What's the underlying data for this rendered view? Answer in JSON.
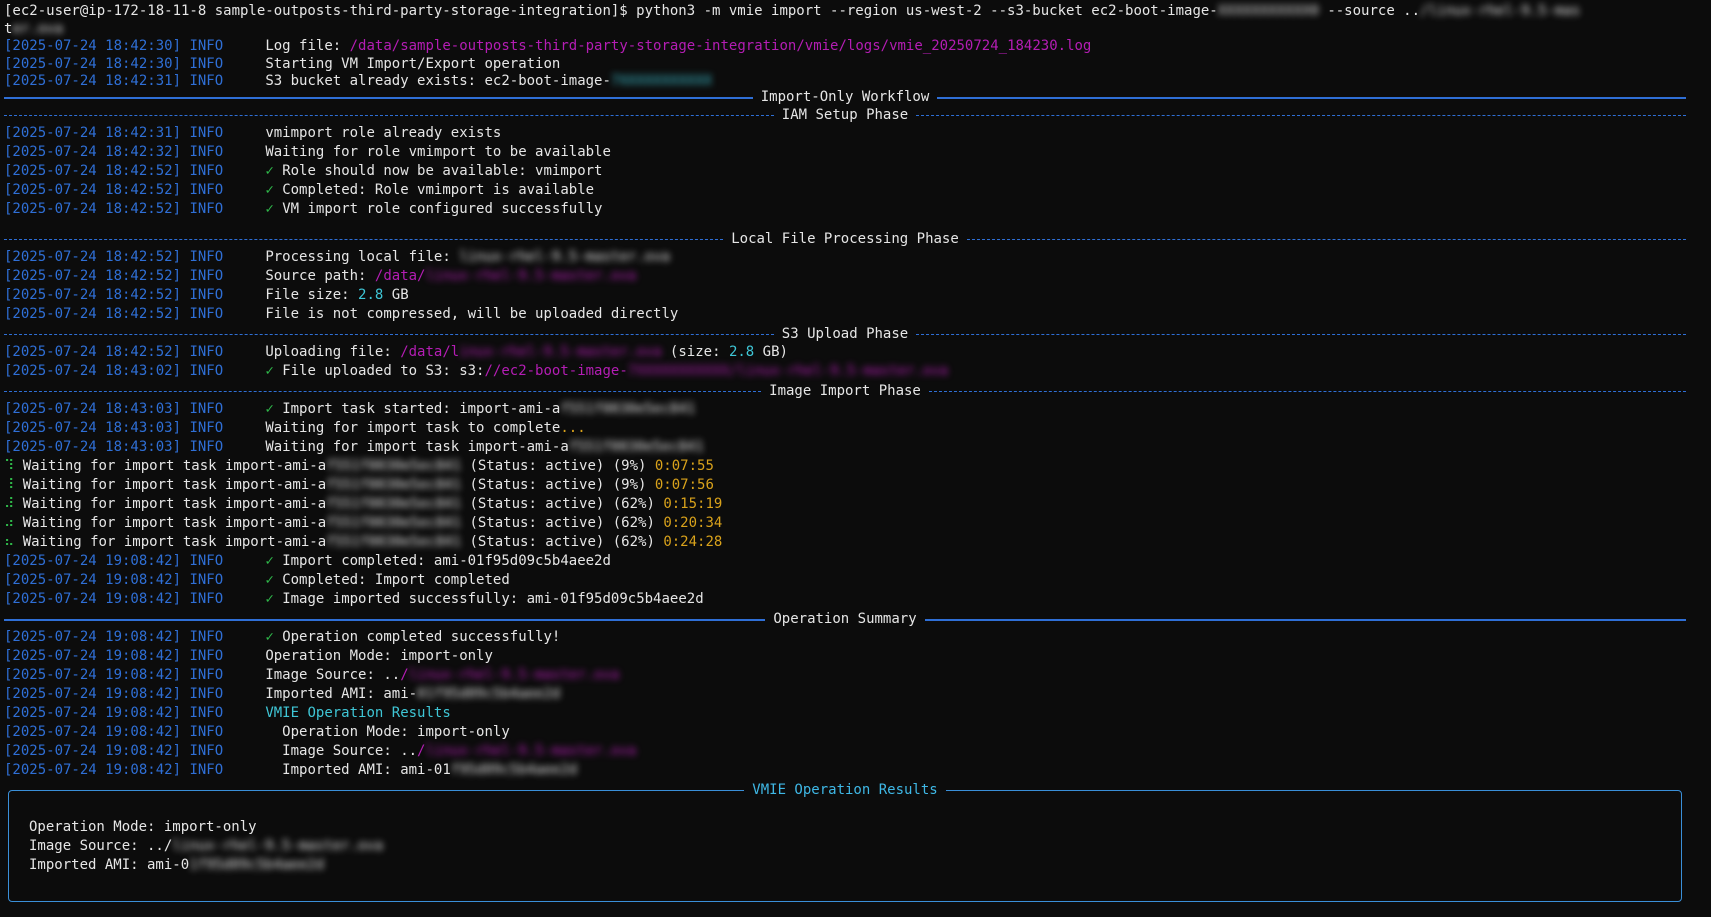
{
  "prompt": {
    "text": "[ec2-user@ip-172-18-11-8 sample-outposts-third-party-storage-integration]$ python3 -m vmie import --region us-west-2 --s3-bucket ec2-boot-image-",
    "bucket_suffix": "XXXXXXXXXXX0",
    "source_flag": " --source ..",
    "source_path": "/linux-rhel-9.5-mas",
    "wrap": "t",
    "wrap_blur": "er.ova"
  },
  "log_lines": [
    {
      "ts": "[2025-07-24 18:42:30]",
      "lvl": "INFO",
      "parts": [
        {
          "t": "Log file: ",
          "c": "msg"
        },
        {
          "t": "/data/sample-outposts-third-party-storage-integration/vmie/logs/vmie_20250724_184230.log",
          "c": "mag"
        }
      ]
    },
    {
      "ts": "[2025-07-24 18:42:30]",
      "lvl": "INFO",
      "parts": [
        {
          "t": "Starting VM Import/Export operation",
          "c": "msg"
        }
      ]
    },
    {
      "ts": "[2025-07-24 18:42:31]",
      "lvl": "INFO",
      "parts": [
        {
          "t": "S3 bucket already exists: ec2-boot-image-",
          "c": "msg"
        },
        {
          "t": "7XXXXXXXXXXX",
          "c": "cyan blur"
        }
      ]
    }
  ],
  "sections": {
    "import_only": "Import-Only Workflow",
    "iam": "IAM Setup Phase",
    "local": "Local File Processing Phase",
    "s3": "S3 Upload Phase",
    "image": "Image Import Phase",
    "summary": "Operation Summary"
  },
  "iam_lines": [
    {
      "ts": "[2025-07-24 18:42:31]",
      "lvl": "INFO",
      "check": false,
      "text": "vmimport role already exists"
    },
    {
      "ts": "[2025-07-24 18:42:32]",
      "lvl": "INFO",
      "check": false,
      "text": "Waiting for role vmimport to be available"
    },
    {
      "ts": "[2025-07-24 18:42:52]",
      "lvl": "INFO",
      "check": true,
      "text": "Role should now be available: vmimport"
    },
    {
      "ts": "[2025-07-24 18:42:52]",
      "lvl": "INFO",
      "check": true,
      "text": "Completed: Role vmimport is available"
    },
    {
      "ts": "[2025-07-24 18:42:52]",
      "lvl": "INFO",
      "check": true,
      "text": "VM import role configured successfully"
    }
  ],
  "local_lines": [
    {
      "ts": "[2025-07-24 18:42:52]",
      "lvl": "INFO",
      "parts": [
        {
          "t": "Processing local file: ",
          "c": "msg"
        },
        {
          "t": "linux-rhel-9.5-master.ova",
          "c": "msg blur"
        }
      ]
    },
    {
      "ts": "[2025-07-24 18:42:52]",
      "lvl": "INFO",
      "parts": [
        {
          "t": "Source path: ",
          "c": "msg"
        },
        {
          "t": "/data/",
          "c": "mag"
        },
        {
          "t": "linux-rhel-9.5-master.ova",
          "c": "mag blur"
        }
      ]
    },
    {
      "ts": "[2025-07-24 18:42:52]",
      "lvl": "INFO",
      "parts": [
        {
          "t": "File size: ",
          "c": "msg"
        },
        {
          "t": "2.8",
          "c": "cyan"
        },
        {
          "t": " GB",
          "c": "msg"
        }
      ]
    },
    {
      "ts": "[2025-07-24 18:42:52]",
      "lvl": "INFO",
      "parts": [
        {
          "t": "File is not compressed, will be uploaded directly",
          "c": "msg"
        }
      ]
    }
  ],
  "s3_lines": [
    {
      "ts": "[2025-07-24 18:42:52]",
      "lvl": "INFO",
      "parts": [
        {
          "t": "Uploading file: ",
          "c": "msg"
        },
        {
          "t": "/data/l",
          "c": "mag"
        },
        {
          "t": "inux-rhel-9.5-master.ova",
          "c": "mag blur"
        },
        {
          "t": " (size: ",
          "c": "msg"
        },
        {
          "t": "2.8",
          "c": "cyan"
        },
        {
          "t": " GB)",
          "c": "msg"
        }
      ]
    },
    {
      "ts": "[2025-07-24 18:43:02]",
      "lvl": "INFO",
      "parts": [
        {
          "t": "✓ ",
          "c": "green"
        },
        {
          "t": "File uploaded to S3: s3:",
          "c": "msg"
        },
        {
          "t": "//ec2-boot-image-",
          "c": "mag"
        },
        {
          "t": "7XXXXXXXXXXX/linux-rhel-9.5-master.ova",
          "c": "mag blur"
        }
      ]
    }
  ],
  "image_lines": [
    {
      "ts": "[2025-07-24 18:43:03]",
      "lvl": "INFO",
      "parts": [
        {
          "t": "✓ ",
          "c": "green"
        },
        {
          "t": "Import task started: import-ami-a",
          "c": "msg"
        },
        {
          "t": "f551f0030e5ec841",
          "c": "msg blur"
        }
      ]
    },
    {
      "ts": "[2025-07-24 18:43:03]",
      "lvl": "INFO",
      "parts": [
        {
          "t": "Waiting for import task to complete",
          "c": "msg"
        },
        {
          "t": "...",
          "c": "yellow"
        }
      ]
    },
    {
      "ts": "[2025-07-24 18:43:03]",
      "lvl": "INFO",
      "parts": [
        {
          "t": "Waiting for import task import-ami-a",
          "c": "msg"
        },
        {
          "t": "f551f0030e5ec841",
          "c": "msg blur"
        }
      ]
    }
  ],
  "progress_lines": [
    {
      "spin": "⠹",
      "prefix": "Waiting for import task import-ami-a",
      "blur": "f551f0030e5ec841 ",
      "status": "(Status: active) (9%) ",
      "time": "0:07:55"
    },
    {
      "spin": "⠸",
      "prefix": "Waiting for import task import-ami-a",
      "blur": "f551f0030e5ec841 ",
      "status": "(Status: active) (9%) ",
      "time": "0:07:56"
    },
    {
      "spin": "⠼",
      "prefix": "Waiting for import task import-ami-a",
      "blur": "f551f0030e5ec841 ",
      "status": "(Status: active) (62%) ",
      "time": "0:15:19"
    },
    {
      "spin": "⠴",
      "prefix": "Waiting for import task import-ami-a",
      "blur": "f551f0030e5ec841 ",
      "status": "(Status: active) (62%) ",
      "time": "0:20:34"
    },
    {
      "spin": "⠦",
      "prefix": "Waiting for import task import-ami-a",
      "blur": "f551f0030e5ec841 ",
      "status": "(Status: active) (62%) ",
      "time": "0:24:28"
    }
  ],
  "import_done_lines": [
    {
      "ts": "[2025-07-24 19:08:42]",
      "lvl": "INFO",
      "text": "Import completed: ami-01f95d09c5b4aee2d"
    },
    {
      "ts": "[2025-07-24 19:08:42]",
      "lvl": "INFO",
      "text": "Completed: Import completed"
    },
    {
      "ts": "[2025-07-24 19:08:42]",
      "lvl": "INFO",
      "text": "Image imported successfully: ami-01f95d09c5b4aee2d"
    }
  ],
  "summary_lines": [
    {
      "ts": "[2025-07-24 19:08:42]",
      "lvl": "INFO",
      "parts": [
        {
          "t": "✓ ",
          "c": "green"
        },
        {
          "t": "Operation completed successfully!",
          "c": "msg"
        }
      ]
    },
    {
      "ts": "[2025-07-24 19:08:42]",
      "lvl": "INFO",
      "parts": [
        {
          "t": "Operation Mode: import-only",
          "c": "msg"
        }
      ]
    },
    {
      "ts": "[2025-07-24 19:08:42]",
      "lvl": "INFO",
      "parts": [
        {
          "t": "Image Source: ..",
          "c": "msg"
        },
        {
          "t": "/",
          "c": "mag"
        },
        {
          "t": "linux-rhel-9.5-master.ova",
          "c": "mag blur"
        }
      ]
    },
    {
      "ts": "[2025-07-24 19:08:42]",
      "lvl": "INFO",
      "parts": [
        {
          "t": "Imported AMI: ami-",
          "c": "msg"
        },
        {
          "t": "01f95d09c5b4aee2d",
          "c": "msg blur"
        }
      ]
    },
    {
      "ts": "[2025-07-24 19:08:42]",
      "lvl": "INFO",
      "parts": [
        {
          "t": "VMIE Operation Results",
          "c": "cyan"
        }
      ]
    },
    {
      "ts": "[2025-07-24 19:08:42]",
      "lvl": "INFO",
      "parts": [
        {
          "t": "  Operation Mode: import-only",
          "c": "msg"
        }
      ]
    },
    {
      "ts": "[2025-07-24 19:08:42]",
      "lvl": "INFO",
      "parts": [
        {
          "t": "  Image Source: ..",
          "c": "msg"
        },
        {
          "t": "/",
          "c": "mag"
        },
        {
          "t": "linux-rhel-9.5-master.ova",
          "c": "mag blur"
        }
      ]
    },
    {
      "ts": "[2025-07-24 19:08:42]",
      "lvl": "INFO",
      "parts": [
        {
          "t": "  Imported AMI: ami-01",
          "c": "msg"
        },
        {
          "t": "f95d09c5b4aee2d",
          "c": "msg blur"
        }
      ]
    }
  ],
  "panel": {
    "title": "VMIE Operation Results",
    "mode": "Operation Mode: import-only",
    "source_prefix": "Image Source: ../",
    "source_blur": "linux-rhel-9.5-master.ova",
    "ami_prefix": "Imported AMI: ami-0",
    "ami_blur": "1f95d09c5b4aee2d"
  },
  "colors": {
    "background": "#0c0c0c",
    "timestamp": "#2f6fd6",
    "path": "#b41db4",
    "number": "#3fc6d6",
    "check": "#2fb84a",
    "elapsed": "#d9a21b"
  }
}
